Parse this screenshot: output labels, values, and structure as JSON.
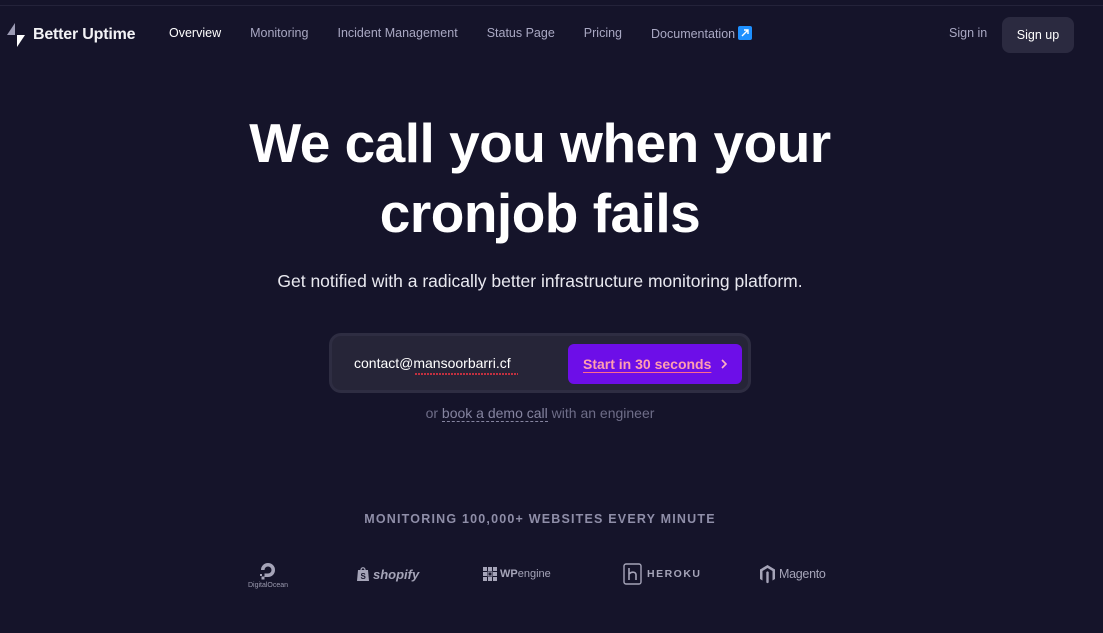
{
  "brand": {
    "name": "Better Uptime",
    "logo_icon": "lightning-bolt-icon"
  },
  "nav": {
    "links": [
      {
        "label": "Overview",
        "active": true
      },
      {
        "label": "Monitoring"
      },
      {
        "label": "Incident Management"
      },
      {
        "label": "Status Page"
      },
      {
        "label": "Pricing"
      },
      {
        "label": "Documentation"
      }
    ],
    "documentation_icon": "external-link-icon",
    "sign_in": "Sign in",
    "sign_up": "Sign up"
  },
  "hero": {
    "title_line1": "We call you when your",
    "title_line2": "cronjob fails",
    "subtitle": "Get notified with a radically better infrastructure monitoring platform."
  },
  "signup_form": {
    "email_value": "contact@mansoorbarri.cf",
    "cta_label": "Start in 30 seconds",
    "cta_icon": "chevron-right-icon"
  },
  "demo": {
    "prefix": "or",
    "link": "book a demo call",
    "suffix": "with an engineer"
  },
  "trusted": {
    "title": "MONITORING 100,000+ WEBSITES EVERY MINUTE",
    "logos": [
      {
        "name": "DigitalOcean",
        "icon": "digitalocean-icon"
      },
      {
        "name": "shopify",
        "icon": "shopify-bag-icon"
      },
      {
        "name": "WP",
        "suffix": "engine",
        "icon": "wpengine-grid-icon"
      },
      {
        "name": "HEROKU",
        "icon": "heroku-icon"
      },
      {
        "name": "Magento",
        "icon": "magento-icon"
      }
    ]
  },
  "colors": {
    "background": "#15142a",
    "cta": "#6d0ee8",
    "cta_text": "#ff9eb0",
    "muted_text": "#a9a8c3"
  }
}
